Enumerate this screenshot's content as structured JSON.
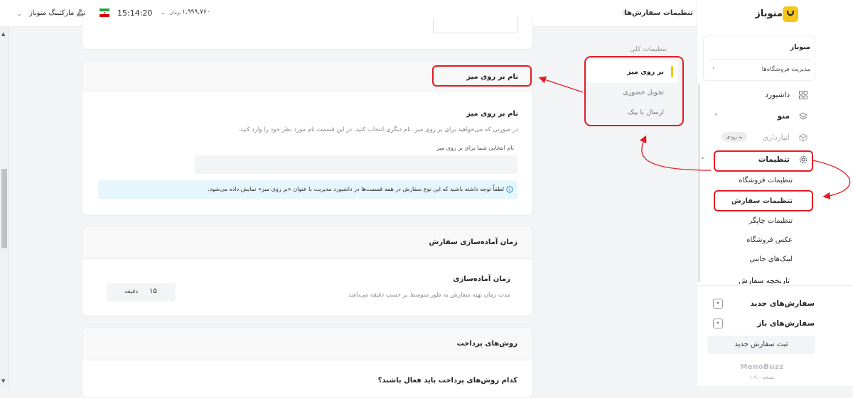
{
  "topbar": {
    "user": "تیم مارکتینگ منوباز",
    "time": "15:14:20",
    "balance": "۱,۹۹۹,۷۶۰",
    "currency": "تومان",
    "page_title": "تنظیمات سفارش‌ها",
    "info_glyph": "i"
  },
  "general_settings": {
    "heading": "تنظیمات کلی",
    "items": [
      {
        "label": "بر روی میز"
      },
      {
        "label": "تحویل حضوری"
      },
      {
        "label": "ارسال با پیک"
      }
    ]
  },
  "table_card": {
    "title": "نام بر روی میز",
    "section_title": "نام بر روی میز",
    "description": "در صورتی که می‌خواهید برای بر روی میز، نام دیگری انتخاب کنید، در این قسمت نام مورد نظر خود را وارد کنید.",
    "input_label": "نام انتخابی شما برای بر روی میز",
    "input_value": "",
    "notice": "لطفاً توجه داشته باشید که این نوع سفارش در همه قسمت‌ها در داشبورد مدیریت با عنوان «بر روی میز» نمایش داده می‌شود."
  },
  "prep_card": {
    "title": "زمان آماده‌سازی سفارش",
    "field_title": "زمان آماده‌سازی",
    "field_desc": "مدت زمان تهیه سفارش به طور متوسط بر حسب دقیقه می‌باشد",
    "value": "۱۵",
    "unit": "دقیقه"
  },
  "payment_card": {
    "title": "روش‌های پرداخت",
    "question": "کدام روش‌های پرداخت باید فعال باشند؟"
  },
  "sidebar": {
    "brand": "منوباز",
    "store_name": "منوباز",
    "store_manage": "مدیریت فروشگاه‌ها",
    "nav": {
      "dashboard": "داشبورد",
      "menu": "منو",
      "inventory": "انبارداری",
      "inventory_badge": "به زودی",
      "settings": "تنظیمات",
      "sub": [
        "تنظیمات فروشگاه",
        "تنظیمات سفارش",
        "تنظیمات چاپگر",
        "عکس فروشگاه",
        "لینک‌های جانبی"
      ],
      "history": "تاریخچه سفارش"
    },
    "new_orders": "سفارش‌های جدید",
    "open_orders": "سفارش‌های باز",
    "new_order_button": "ثبت سفارش جدید",
    "footer_brand": "MenoBuzz",
    "version": "نسخه ۱.۹.۰"
  },
  "colors": {
    "accent": "#f5c518",
    "annotation": "#e41b23",
    "notice_bg": "#e6f6fc"
  }
}
